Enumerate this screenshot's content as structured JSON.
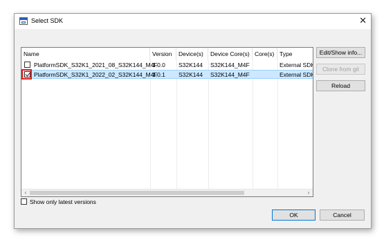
{
  "window": {
    "title": "Select SDK",
    "close_glyph": "✕"
  },
  "table": {
    "columns": [
      "Name",
      "Version",
      "Device(s)",
      "Device Core(s)",
      "Core(s)",
      "Type"
    ],
    "rows": [
      {
        "checked": false,
        "selected": false,
        "cells": [
          "PlatformSDK_S32K1_2021_08_S32K144_M4F",
          "1.0.0",
          "S32K144",
          "S32K144_M4F",
          "",
          "External SDK"
        ]
      },
      {
        "checked": true,
        "selected": true,
        "cells": [
          "PlatformSDK_S32K1_2022_02_S32K144_M4F",
          "1.0.1",
          "S32K144",
          "S32K144_M4F",
          "",
          "External SDK"
        ]
      }
    ]
  },
  "side_buttons": {
    "edit": "Edit/Show info...",
    "clone": "Clone from git",
    "reload": "Reload"
  },
  "options": {
    "show_latest": "Show only latest versions",
    "show_latest_checked": false
  },
  "footer": {
    "ok": "OK",
    "cancel": "Cancel"
  },
  "scroll": {
    "left_arrow": "‹",
    "right_arrow": "›"
  }
}
